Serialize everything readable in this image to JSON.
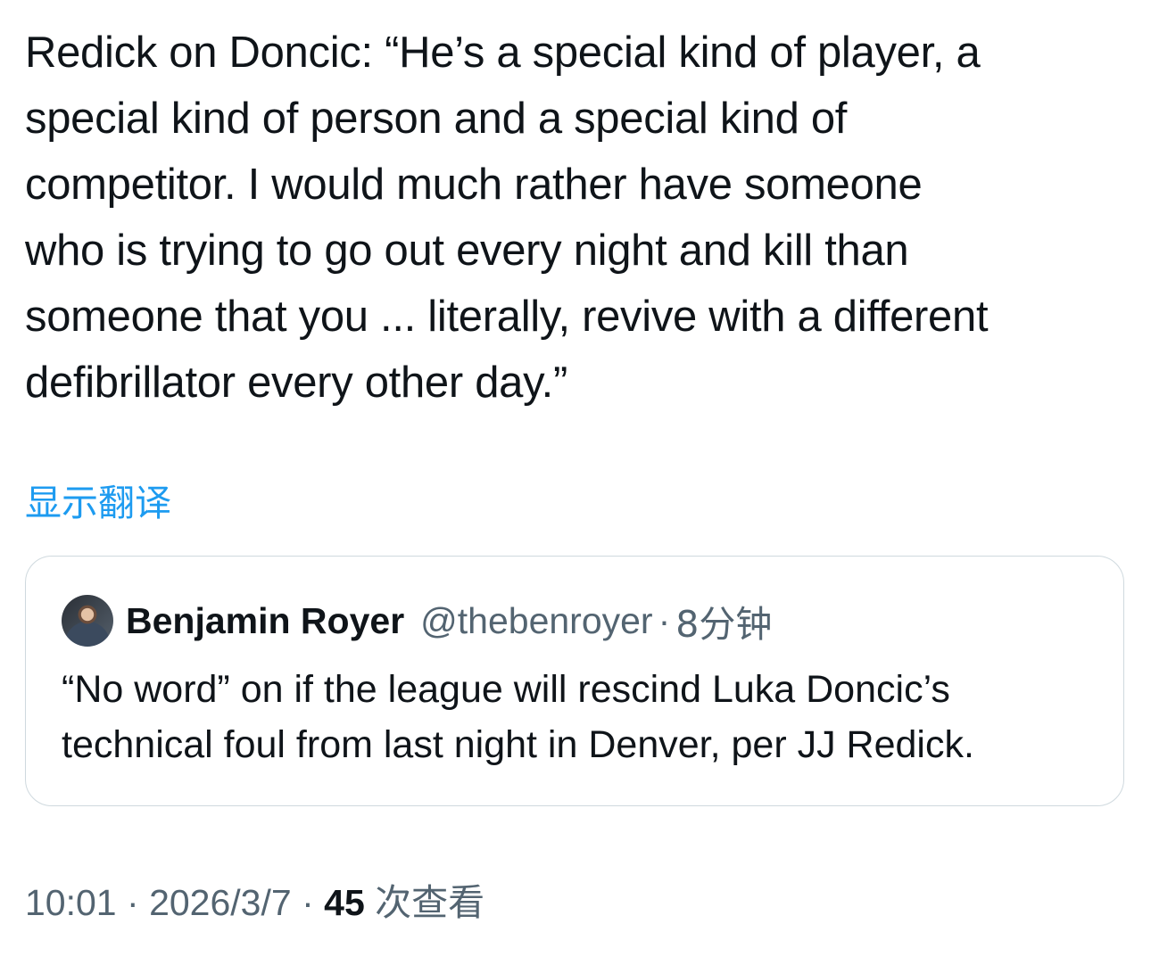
{
  "tweet": {
    "text": "Redick on Doncic: “He’s a special kind of player, a\nspecial kind of person and a special kind of\ncompetitor. I would much rather have someone\nwho is trying to go out every night and kill than\nsomeone that you ... literally, revive with a different\ndefibrillator every other day.”",
    "translate_label": "显示翻译"
  },
  "quoted_tweet": {
    "author_name": "Benjamin Royer",
    "author_handle": "@thebenroyer",
    "separator": "·",
    "time_ago": "8分钟",
    "text": "“No word” on if the league will rescind Luka Doncic’s\ntechnical foul from last night in Denver, per JJ Redick."
  },
  "meta": {
    "time": "10:01",
    "separator": "·",
    "date": "2026/3/7",
    "views_count": "45",
    "views_label": "次查看"
  },
  "colors": {
    "link": "#1d9bf0",
    "secondary_text": "#536471",
    "primary_text": "#0f1419",
    "border": "#cfd9de"
  }
}
